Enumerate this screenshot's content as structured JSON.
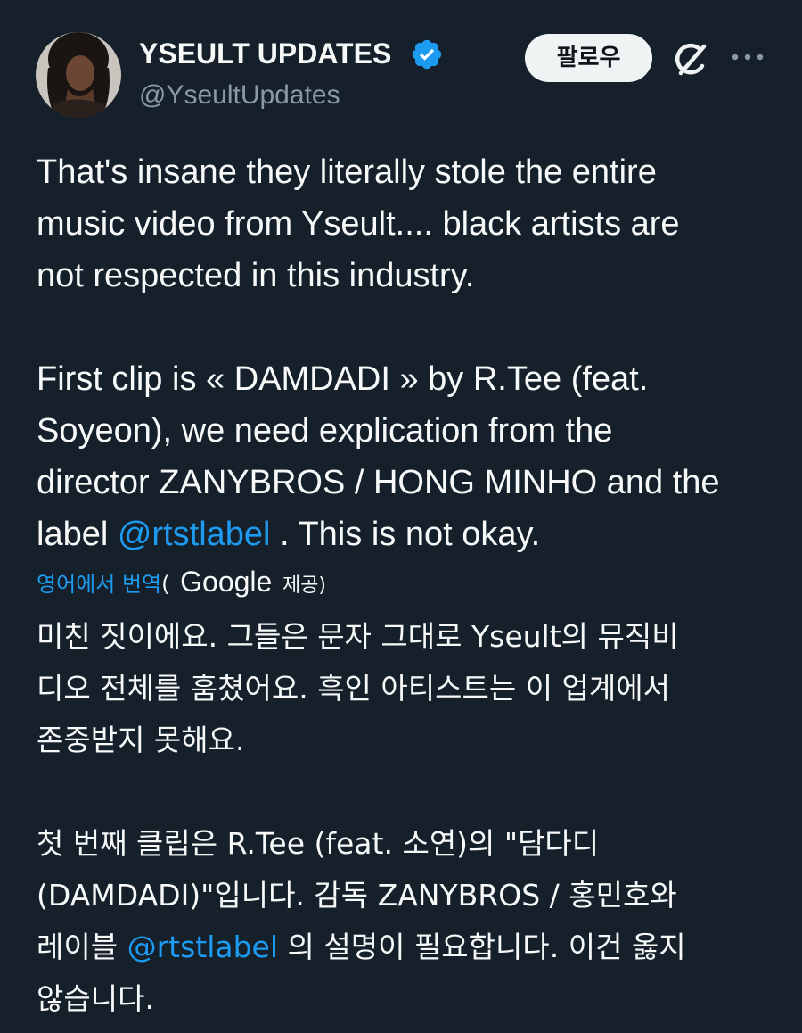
{
  "header": {
    "display_name": "YSEULT UPDATES",
    "handle": "@YseultUpdates",
    "follow_label": "팔로우",
    "avatar_icon": "profile-photo",
    "verified_icon": "verified-badge-icon",
    "grok_icon": "grok-icon",
    "more_icon": "more-options-icon"
  },
  "tweet": {
    "lines": [
      "That's insane they literally stole the entire",
      "music video from Yseult.... black artists are",
      "not respected in this industry."
    ],
    "lines2": [
      "First clip is « DAMDADI » by R.Tee (feat.",
      "Soyeon), we need explication from the",
      "director ZANYBROS / HONG MINHO and the"
    ],
    "last_line_before": "label ",
    "last_line_mention": "@rtstlabel",
    "last_line_after": " . This is not okay."
  },
  "translation": {
    "link_label": "영어에서 번역",
    "open_paren": "(",
    "provider": "Google",
    "provide_label": "제공)",
    "lines": [
      "미친 짓이에요. 그들은 문자 그대로 Yseult의 뮤직비",
      "디오 전체를 훔쳤어요. 흑인 아티스트는 이 업계에서",
      "존중받지 못해요."
    ],
    "lines2": [
      "첫 번째 클립은 R.Tee (feat. 소연)의 \"담다디",
      "(DAMDADI)\"입니다. 감독 ZANYBROS / 홍민호와"
    ],
    "line_mention_before": "레이블 ",
    "line_mention": "@rtstlabel",
    "line_mention_after": " 의 설명이 필요합니다. 이건 옳지",
    "final_line": "않습니다."
  },
  "colors": {
    "background": "#15202b",
    "text": "#f7f9f9",
    "secondary": "#8b98a5",
    "accent": "#1d9bf0"
  }
}
